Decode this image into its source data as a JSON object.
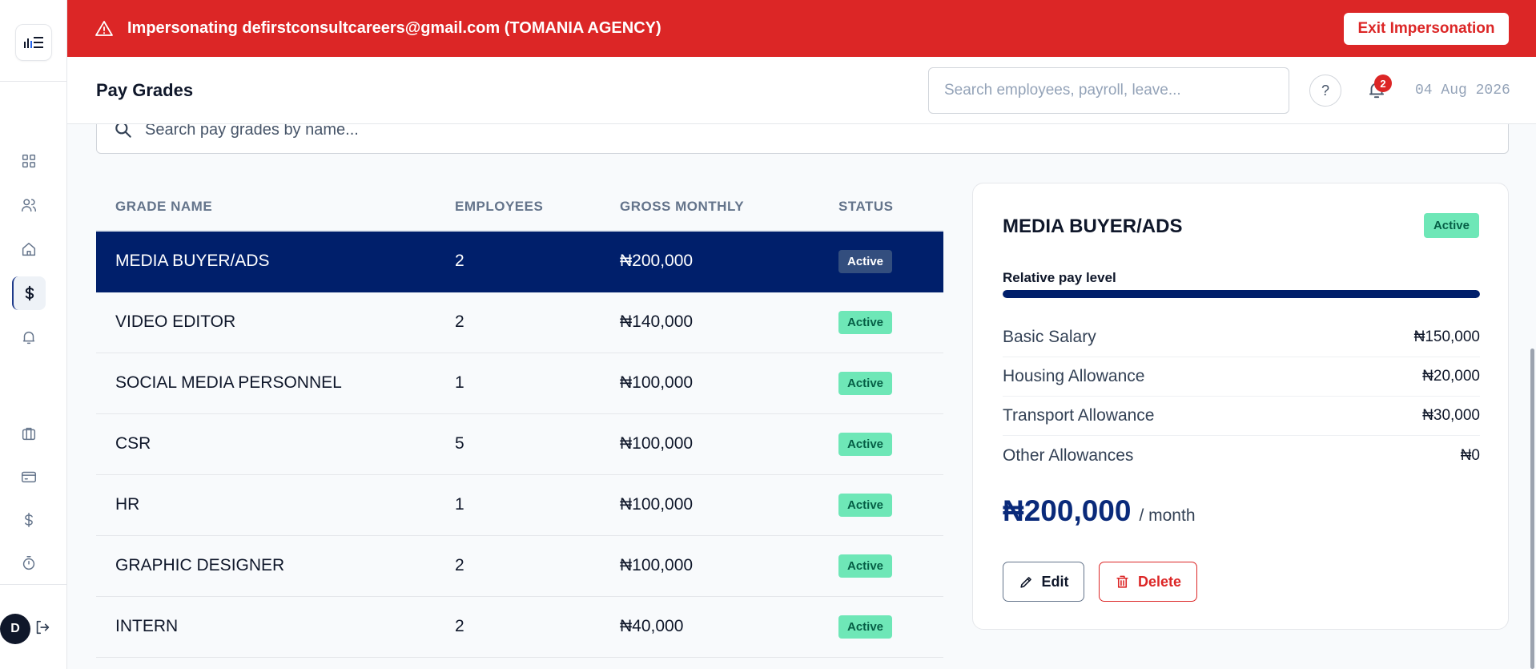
{
  "banner": {
    "text": "Impersonating defirstconsultcareers@gmail.com (TOMANIA AGENCY)",
    "exit_label": "Exit Impersonation"
  },
  "header": {
    "title": "Pay Grades",
    "search_placeholder": "Search employees, payroll, leave...",
    "help_label": "?",
    "notification_count": "2",
    "date": "04 Aug 2026"
  },
  "sidebar": {
    "items": [
      {
        "icon": "dashboard-grid-icon"
      },
      {
        "icon": "users-icon"
      },
      {
        "icon": "home-icon"
      },
      {
        "icon": "dollar-icon",
        "active": true
      },
      {
        "icon": "bell-outline-icon"
      },
      {
        "icon": "briefcase-icon"
      },
      {
        "icon": "credit-card-icon"
      },
      {
        "icon": "dollar-icon"
      },
      {
        "icon": "timer-icon"
      }
    ],
    "avatar_initial": "D"
  },
  "grade_search": {
    "placeholder": "Search pay grades by name..."
  },
  "table": {
    "headers": [
      "GRADE NAME",
      "EMPLOYEES",
      "GROSS MONTHLY",
      "STATUS"
    ],
    "rows": [
      {
        "name": "MEDIA BUYER/ADS",
        "employees": "2",
        "gross": "₦200,000",
        "status": "Active"
      },
      {
        "name": "VIDEO EDITOR",
        "employees": "2",
        "gross": "₦140,000",
        "status": "Active"
      },
      {
        "name": "SOCIAL MEDIA PERSONNEL",
        "employees": "1",
        "gross": "₦100,000",
        "status": "Active"
      },
      {
        "name": "CSR",
        "employees": "5",
        "gross": "₦100,000",
        "status": "Active"
      },
      {
        "name": "HR",
        "employees": "1",
        "gross": "₦100,000",
        "status": "Active"
      },
      {
        "name": "GRAPHIC DESIGNER",
        "employees": "2",
        "gross": "₦100,000",
        "status": "Active"
      },
      {
        "name": "INTERN",
        "employees": "2",
        "gross": "₦40,000",
        "status": "Active"
      }
    ]
  },
  "detail": {
    "title": "MEDIA BUYER/ADS",
    "status": "Active",
    "pay_level_label": "Relative pay level",
    "pay_level_fraction": 1.0,
    "components": [
      {
        "label": "Basic Salary",
        "value": "₦150,000"
      },
      {
        "label": "Housing Allowance",
        "value": "₦20,000"
      },
      {
        "label": "Transport Allowance",
        "value": "₦30,000"
      },
      {
        "label": "Other Allowances",
        "value": "₦0"
      }
    ],
    "total": "₦200,000",
    "total_unit": "/ month",
    "edit_label": "Edit",
    "delete_label": "Delete"
  },
  "colors": {
    "banner": "#dc2626",
    "selected_row": "#001f6b",
    "active_badge": "#6ee7b7",
    "active_badge_text": "#065f46"
  }
}
